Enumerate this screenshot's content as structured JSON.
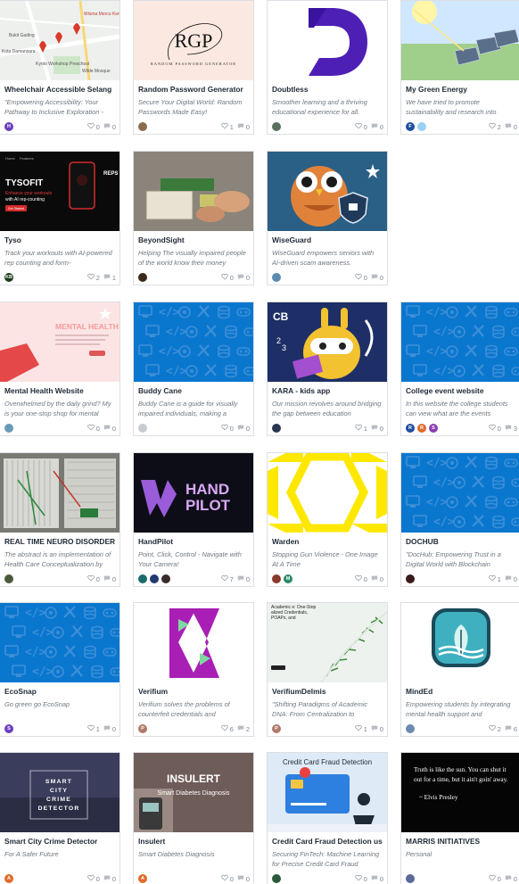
{
  "cards": [
    {
      "title": "Wheelchair Accessible Selang",
      "desc": "\"Empowering Accessibility: Your Pathway to Inclusive Exploration -",
      "likes": "0",
      "comments": "0",
      "thumb": "map",
      "avatars": [
        {
          "color": "#6a3fc0",
          "letter": "H"
        }
      ],
      "map_labels": [
        "Wisma Mercu Kembing Sdn",
        "Kota Damansara",
        "Bukit Gading",
        "Kyoto Workshop Preschool",
        "Wilde Mosque"
      ]
    },
    {
      "title": "Random Password Generator",
      "desc": "Secure Your Digital World: Random Passwords Made Easy!",
      "likes": "1",
      "comments": "0",
      "thumb": "rgp",
      "avatars": [
        {
          "color": "#8a6b50",
          "letter": ""
        }
      ],
      "logo_text": "RGP",
      "logo_sub": "RANDOM PASSWORD GENERATOR"
    },
    {
      "title": "Doubtless",
      "desc": "Smoother learning and a thriving educational experience for all.",
      "likes": "0",
      "comments": "0",
      "thumb": "doubtless",
      "avatars": [
        {
          "color": "#5a7060",
          "letter": ""
        }
      ]
    },
    {
      "title": "My Green Energy",
      "desc": "We have tried to promote sustainability and research into",
      "likes": "2",
      "comments": "0",
      "thumb": "solar",
      "avatars": [
        {
          "color": "#1f4fa0",
          "letter": "F"
        },
        {
          "color": "#9ad1f5",
          "letter": ""
        }
      ]
    },
    {
      "title": "Tyso",
      "desc": "Track your workouts with AI-powered rep counting and form-",
      "likes": "2",
      "comments": "1",
      "thumb": "tyso",
      "avatars": [
        {
          "color": "#1a3a1a",
          "letter": "KB"
        }
      ],
      "screen_texts": [
        "Home",
        "Features",
        "TYSOFIT",
        "Enhance your workouts",
        "with AI rep-counting",
        "Get Started",
        "REPS"
      ]
    },
    {
      "title": "BeyondSight",
      "desc": "Helping The visually impaired people of the world know their money",
      "likes": "0",
      "comments": "0",
      "thumb": "beyond",
      "avatars": [
        {
          "color": "#3b2a1a",
          "letter": ""
        }
      ]
    },
    {
      "title": "WiseGuard",
      "desc": "WiseGuard empowers seniors with AI-driven scam awareness.",
      "likes": "0",
      "comments": "0",
      "thumb": "owl",
      "avatars": [
        {
          "color": "#5a8ab0",
          "letter": ""
        }
      ]
    },
    {
      "title": "Mental Health Website",
      "desc": "Overwhelmed by the daily grind? My is your one-stop shop for mental",
      "likes": "0",
      "comments": "0",
      "thumb": "mental",
      "avatars": [
        {
          "color": "#6a9ab8",
          "letter": ""
        }
      ],
      "banner": "MENTAL HEALTH"
    },
    {
      "title": "Buddy Cane",
      "desc": "Buddy Cane is a guide for visually impaired individuals, making a",
      "likes": "0",
      "comments": "0",
      "thumb": "pattern",
      "avatars": [
        {
          "color": "#c8ccd0",
          "letter": ""
        }
      ]
    },
    {
      "title": "KARA - kids app",
      "desc": "Our mission revolves around bridging the gap between education",
      "likes": "1",
      "comments": "0",
      "thumb": "kara",
      "avatars": [
        {
          "color": "#2a3550",
          "letter": ""
        }
      ]
    },
    {
      "title": "College event website",
      "desc": "In this website the college students can view what are the events",
      "likes": "0",
      "comments": "3",
      "thumb": "pattern",
      "avatars": [
        {
          "color": "#1f4fa0",
          "letter": "R"
        },
        {
          "color": "#e06b2b",
          "letter": "R"
        },
        {
          "color": "#8a3fb0",
          "letter": "S"
        }
      ]
    },
    {
      "title": "REAL TIME NEURO DISORDER",
      "desc": "The abstract is an implementation of Health Care Conceptualization by",
      "likes": "0",
      "comments": "0",
      "thumb": "board",
      "avatars": [
        {
          "color": "#4a5a3a",
          "letter": ""
        }
      ]
    },
    {
      "title": "HandPilot",
      "desc": "Point, Click, Control - Navigate with Your Camera!",
      "likes": "7",
      "comments": "0",
      "thumb": "handpilot",
      "avatars": [
        {
          "color": "#1a6b6b",
          "letter": ""
        },
        {
          "color": "#203a70",
          "letter": ""
        },
        {
          "color": "#3a2a2a",
          "letter": ""
        }
      ],
      "logo_text1": "HAND",
      "logo_text2": "PILOT"
    },
    {
      "title": "Warden",
      "desc": "Stopping Gun Violence - One Image At A Time",
      "likes": "0",
      "comments": "0",
      "thumb": "warden",
      "avatars": [
        {
          "color": "#8a3a2a",
          "letter": ""
        },
        {
          "color": "#2a8a6a",
          "letter": "M"
        }
      ]
    },
    {
      "title": "DOCHUB",
      "desc": "\"DocHub: Empowering Trust in a Digital World with Blockchain",
      "likes": "1",
      "comments": "0",
      "thumb": "pattern",
      "avatars": [
        {
          "color": "#3a1a1a",
          "letter": ""
        }
      ]
    },
    {
      "title": "EcoSnap",
      "desc": "Go green go EcoSnap",
      "likes": "1",
      "comments": "0",
      "thumb": "pattern",
      "avatars": [
        {
          "color": "#6a3fc0",
          "letter": "S"
        }
      ]
    },
    {
      "title": "Verifium",
      "desc": "Verifium solves the problems of counterfeit credentials and",
      "likes": "6",
      "comments": "2",
      "thumb": "verifium",
      "avatars": [
        {
          "color": "#b07a6a",
          "letter": "P"
        }
      ]
    },
    {
      "title": "VerifiumDelmis",
      "desc": "\"Shifting Paradigms of Academic DNA: From Centralization to",
      "likes": "1",
      "comments": "0",
      "thumb": "dna",
      "avatars": [
        {
          "color": "#b07a6a",
          "letter": "P"
        }
      ],
      "slide_text": "Academic e: One-Stop alized Credentials, POAPs, and"
    },
    {
      "title": "MindEd",
      "desc": "Empowering students by integrating mental health support and",
      "likes": "2",
      "comments": "6",
      "thumb": "minded",
      "avatars": [
        {
          "color": "#6a8ab0",
          "letter": ""
        }
      ]
    },
    {
      "title": "Smart City Crime Detector",
      "desc": "For A Safer Future",
      "likes": "0",
      "comments": "0",
      "thumb": "city",
      "avatars": [
        {
          "color": "#e06b2b",
          "letter": "A"
        }
      ],
      "overlay_text": "SMART CITY CRIME DETECTOR"
    },
    {
      "title": "Insulert",
      "desc": "Smart Diabetes Diagnosis",
      "likes": "0",
      "comments": "0",
      "thumb": "insulert",
      "avatars": [
        {
          "color": "#e06b2b",
          "letter": "A"
        }
      ],
      "overlay_title": "INSULERT",
      "overlay_sub": "Smart Diabetes Diagnosis"
    },
    {
      "title": "Credit Card Fraud Detection us",
      "desc": "Securing FinTech: Machine Learning for Precise Credit Card Fraud",
      "likes": "0",
      "comments": "0",
      "thumb": "credit",
      "avatars": [
        {
          "color": "#2a5a3a",
          "letter": ""
        }
      ],
      "overlay_title": "Credit Card Fraud Detection"
    },
    {
      "title": "MARRIS INITIATIVES",
      "desc": "Personal",
      "likes": "0",
      "comments": "0",
      "thumb": "quote",
      "avatars": [
        {
          "color": "#5a6a9a",
          "letter": ""
        }
      ],
      "quote": "Truth is like the sun. You can shut it out for a time, but it ain't goin' away.",
      "quote_author": "~ Elvis Presley"
    }
  ]
}
